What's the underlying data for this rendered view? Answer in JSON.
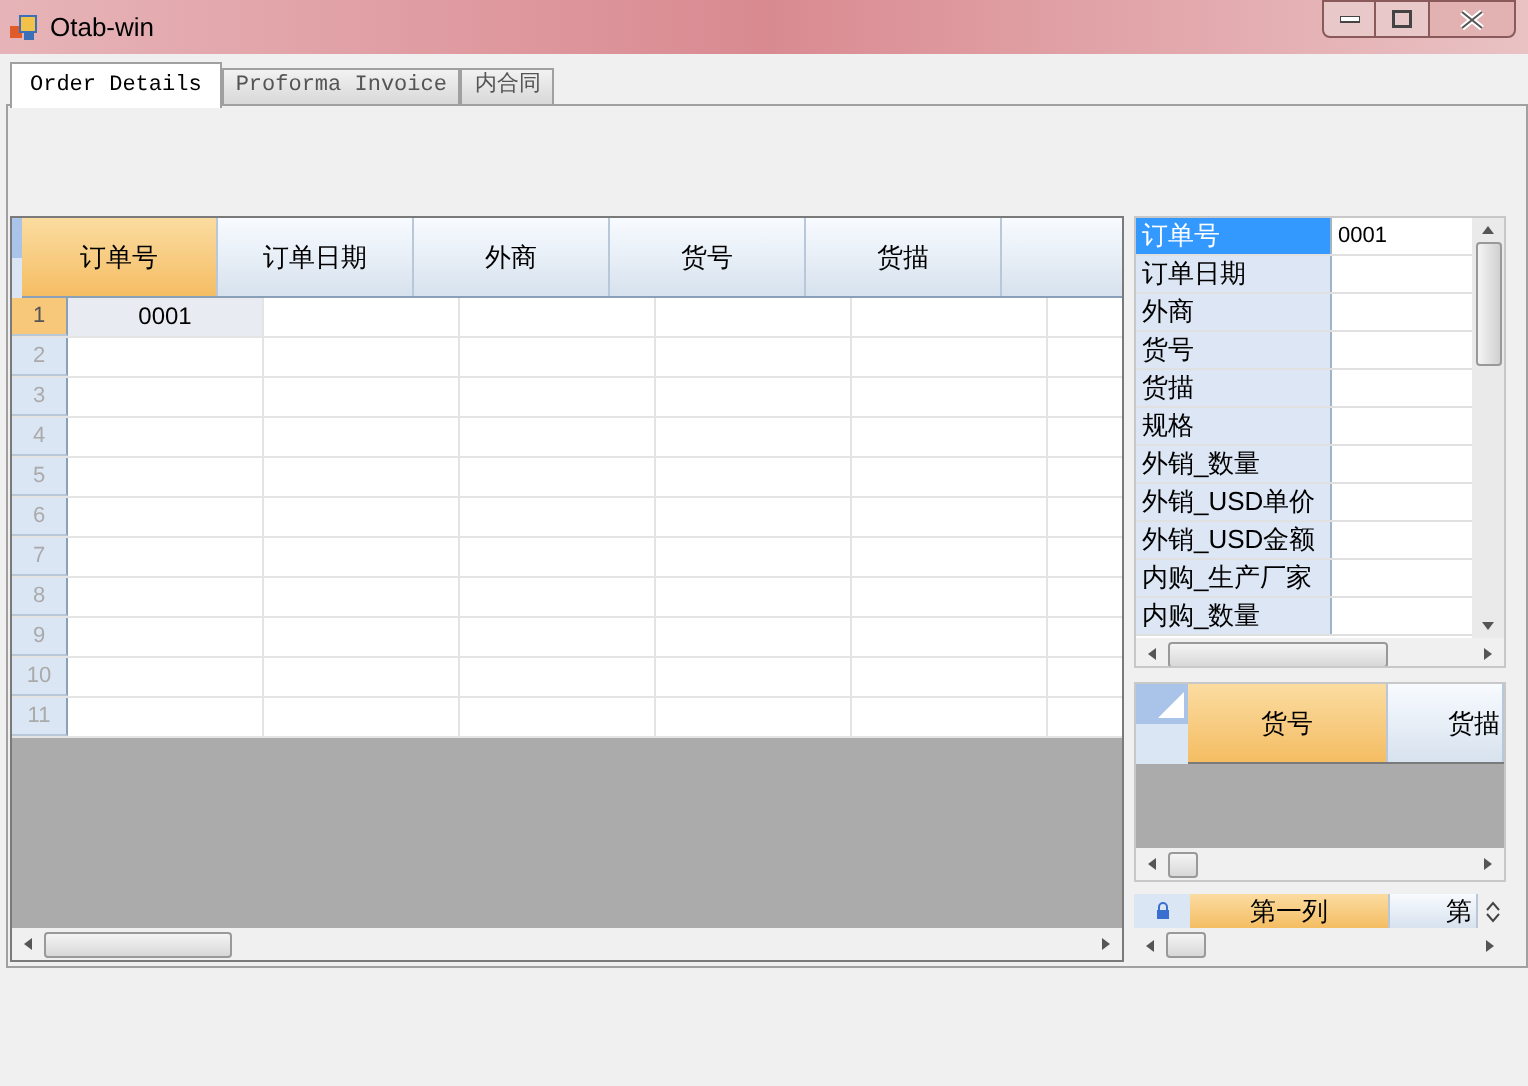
{
  "window": {
    "title": "Otab-win"
  },
  "tabs": [
    {
      "label": "Order Details",
      "selected": true
    },
    {
      "label": "Proforma Invoice",
      "selected": false
    },
    {
      "label": "内合同",
      "selected": false
    }
  ],
  "main_grid": {
    "columns": [
      {
        "label": "订单号",
        "selected": true
      },
      {
        "label": "订单日期",
        "selected": false
      },
      {
        "label": "外商",
        "selected": false
      },
      {
        "label": "货号",
        "selected": false
      },
      {
        "label": "货描",
        "selected": false
      }
    ],
    "rows": [
      {
        "number": "1",
        "selected": true,
        "cells": [
          "0001"
        ]
      },
      {
        "number": "2",
        "selected": false
      },
      {
        "number": "3",
        "selected": false
      },
      {
        "number": "4",
        "selected": false
      },
      {
        "number": "5",
        "selected": false
      },
      {
        "number": "6",
        "selected": false
      },
      {
        "number": "7",
        "selected": false
      },
      {
        "number": "8",
        "selected": false
      },
      {
        "number": "9",
        "selected": false
      },
      {
        "number": "10",
        "selected": false
      },
      {
        "number": "11",
        "selected": false
      }
    ]
  },
  "property_grid": {
    "rows": [
      {
        "label": "订单号",
        "value": "0001",
        "selected": true
      },
      {
        "label": "订单日期",
        "selected": false
      },
      {
        "label": "外商",
        "selected": false
      },
      {
        "label": "货号",
        "selected": false
      },
      {
        "label": "货描",
        "selected": false
      },
      {
        "label": "规格",
        "selected": false
      },
      {
        "label": "外销_数量",
        "selected": false
      },
      {
        "label": "外销_USD单价",
        "selected": false
      },
      {
        "label": "外销_USD金额",
        "selected": false
      },
      {
        "label": "内购_生产厂家",
        "selected": false
      },
      {
        "label": "内购_数量",
        "selected": false
      }
    ]
  },
  "detail_grid": {
    "columns": [
      {
        "label": "货号",
        "selected": true
      },
      {
        "label": "货描",
        "selected": false
      }
    ]
  },
  "column_grid": {
    "columns": [
      {
        "label": "第一列",
        "selected": true
      },
      {
        "label": "第",
        "selected": false
      }
    ]
  }
}
